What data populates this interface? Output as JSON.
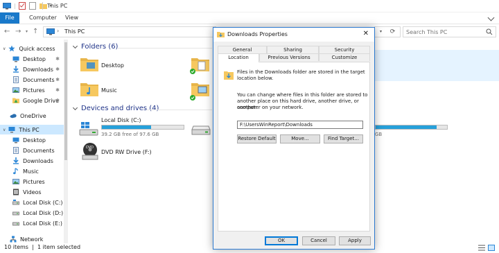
{
  "window": {
    "title": "This PC",
    "qat_separator": "|"
  },
  "ribbon": {
    "tabs": [
      "File",
      "Computer",
      "View"
    ]
  },
  "address": {
    "crumb": "This PC",
    "crumb_sep": "›",
    "search_placeholder": "Search This PC"
  },
  "nav": {
    "items": [
      {
        "label": "Quick access",
        "icon": "star-icon",
        "pinned": false
      },
      {
        "label": "Desktop",
        "icon": "desktop-folder-icon",
        "pinned": true
      },
      {
        "label": "Downloads",
        "icon": "downloads-icon",
        "pinned": true
      },
      {
        "label": "Documents",
        "icon": "documents-icon",
        "pinned": true
      },
      {
        "label": "Pictures",
        "icon": "pictures-icon",
        "pinned": true
      },
      {
        "label": "Google Drive",
        "icon": "google-drive-icon",
        "pinned": true
      },
      {
        "label": "OneDrive",
        "icon": "onedrive-icon",
        "pinned": false
      },
      {
        "label": "This PC",
        "icon": "this-pc-icon",
        "pinned": false
      },
      {
        "label": "Desktop",
        "icon": "desktop-folder-icon",
        "pinned": false
      },
      {
        "label": "Documents",
        "icon": "documents-icon",
        "pinned": false
      },
      {
        "label": "Downloads",
        "icon": "downloads-icon",
        "pinned": false
      },
      {
        "label": "Music",
        "icon": "music-icon",
        "pinned": false
      },
      {
        "label": "Pictures",
        "icon": "pictures-icon",
        "pinned": false
      },
      {
        "label": "Videos",
        "icon": "videos-icon",
        "pinned": false
      },
      {
        "label": "Local Disk (C:)",
        "icon": "drive-icon",
        "pinned": false
      },
      {
        "label": "Local Disk (D:)",
        "icon": "drive-icon",
        "pinned": false
      },
      {
        "label": "Local Disk (E:)",
        "icon": "drive-icon",
        "pinned": false
      },
      {
        "label": "Network",
        "icon": "network-icon",
        "pinned": false
      }
    ],
    "pin_glyph": "✱"
  },
  "content": {
    "folders_header": "Folders (6)",
    "drives_header": "Devices and drives (4)",
    "folders": [
      "Desktop",
      "Music"
    ],
    "drive_c": {
      "label": "Local Disk (C:)",
      "free": "39.2 GB free of 97.6 GB",
      "used_fraction": 0.6
    },
    "drive_dvd": {
      "label": "DVD RW Drive (F:)"
    },
    "drive_right_free": "GB",
    "drive_right_used_fraction": 0.85
  },
  "status": {
    "items": "10 items",
    "selected": "1 item selected"
  },
  "dialog": {
    "title": "Downloads Properties",
    "close": "✕",
    "tabs_row1": [
      "General",
      "Sharing",
      "Security"
    ],
    "tabs_row2": [
      "Location",
      "Previous Versions",
      "Customize"
    ],
    "active_tab": "Location",
    "info_line1": "Files in the Downloads folder are stored in the target",
    "info_line2": "location below.",
    "desc_line1": "You can change where files in this folder are stored to",
    "desc_line2": "another place on this hard drive, another drive, or another",
    "desc_line3": "computer on your network.",
    "path": "F:\\UsersWinReport\\Downloads",
    "btn_restore": "Restore Default",
    "btn_move": "Move...",
    "btn_find": "Find Target...",
    "btn_ok": "OK",
    "btn_cancel": "Cancel",
    "btn_apply": "Apply"
  },
  "colors": {
    "accent": "#1979ca",
    "selection": "#cce8ff",
    "drive_fill": "#26a0da",
    "folder": "#f6c85f"
  }
}
